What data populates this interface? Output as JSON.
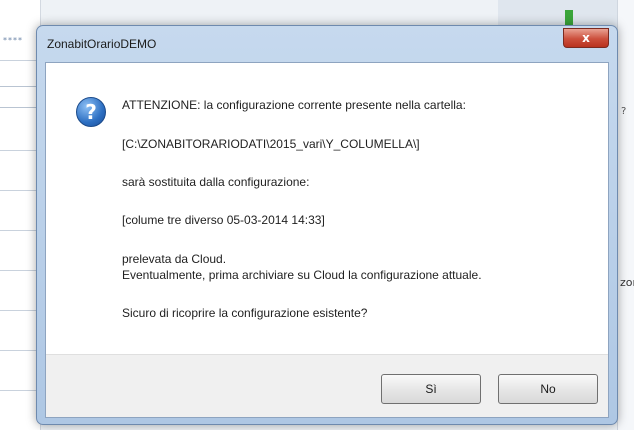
{
  "background": {
    "left_stars": "****",
    "right_question": "?",
    "right_cutoff": "zor"
  },
  "dialog": {
    "title": "ZonabitOrarioDEMO",
    "close_label": "x",
    "icon": "question-icon",
    "icon_glyph": "?",
    "message_lines": [
      "ATTENZIONE: la configurazione corrente presente nella cartella:",
      "[C:\\ZONABITORARIODATI\\2015_vari\\Y_COLUMELLA\\]",
      "sarà sostituita dalla configurazione:",
      "[colume tre diverso 05-03-2014 14:33]",
      "prelevata da Cloud.",
      "Eventualmente, prima archiviare su Cloud la configurazione attuale.",
      "Sicuro di ricoprire la configurazione esistente?"
    ],
    "buttons": {
      "yes_label": "Sì",
      "no_label": "No"
    }
  },
  "colors": {
    "titlebar": "#c6d9ee",
    "close": "#cc4f3c",
    "icon": "#2d6fc2"
  }
}
